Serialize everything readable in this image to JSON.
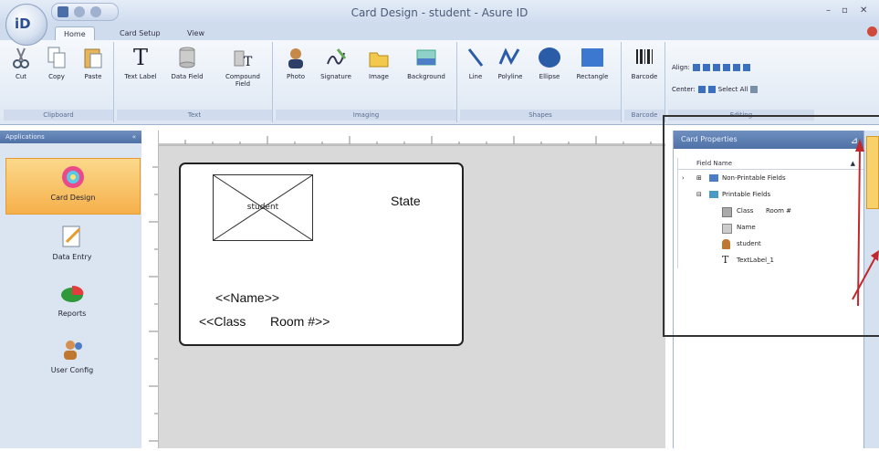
{
  "window": {
    "title": "Card Design - student - Asure ID",
    "minimize": "–",
    "maximize": "▫",
    "close": "✕"
  },
  "logo_text": "iD",
  "tabs": [
    "Home",
    "Card Setup",
    "View"
  ],
  "ribbon": {
    "clipboard": {
      "label": "Clipboard",
      "buttons": [
        "Cut",
        "Copy",
        "Paste"
      ]
    },
    "text": {
      "label": "Text",
      "buttons": [
        "Text Label",
        "Data Field",
        "Compound Field"
      ]
    },
    "imaging": {
      "label": "Imaging",
      "buttons": [
        "Photo",
        "Signature",
        "Image",
        "Background"
      ]
    },
    "shapes": {
      "label": "Shapes",
      "buttons": [
        "Line",
        "Polyline",
        "Ellipse",
        "Rectangle"
      ]
    },
    "barcode": {
      "label": "Barcode",
      "button": "Barcode"
    },
    "editing": {
      "label": "Editing",
      "align": "Align:",
      "center": "Center:",
      "select_all": "Select All"
    }
  },
  "nav": {
    "header": "Applications",
    "items": [
      {
        "label": "Card Design",
        "icon": "card-design-icon"
      },
      {
        "label": "Data Entry",
        "icon": "data-entry-icon"
      },
      {
        "label": "Reports",
        "icon": "reports-icon"
      },
      {
        "label": "User Config",
        "icon": "user-config-icon"
      }
    ]
  },
  "card": {
    "photo_label": "student",
    "state": "State",
    "name_field": "<<Name>>",
    "class_field": "<<Class",
    "room_field": "Room #>>"
  },
  "properties": {
    "header": "Card Properties",
    "column": "Field Name",
    "rows": [
      {
        "label": "Non-Printable Fields",
        "expander": "⊞"
      },
      {
        "label": "Printable Fields",
        "expander": "⊟"
      },
      {
        "label": "Class",
        "value": "Room #"
      },
      {
        "label": "Name"
      },
      {
        "label": "student"
      },
      {
        "label": "TextLabel_1"
      }
    ]
  },
  "colors": {
    "accent": "#4f71a6",
    "active_nav": "#f6b04b",
    "arrow": "#c0282d"
  }
}
